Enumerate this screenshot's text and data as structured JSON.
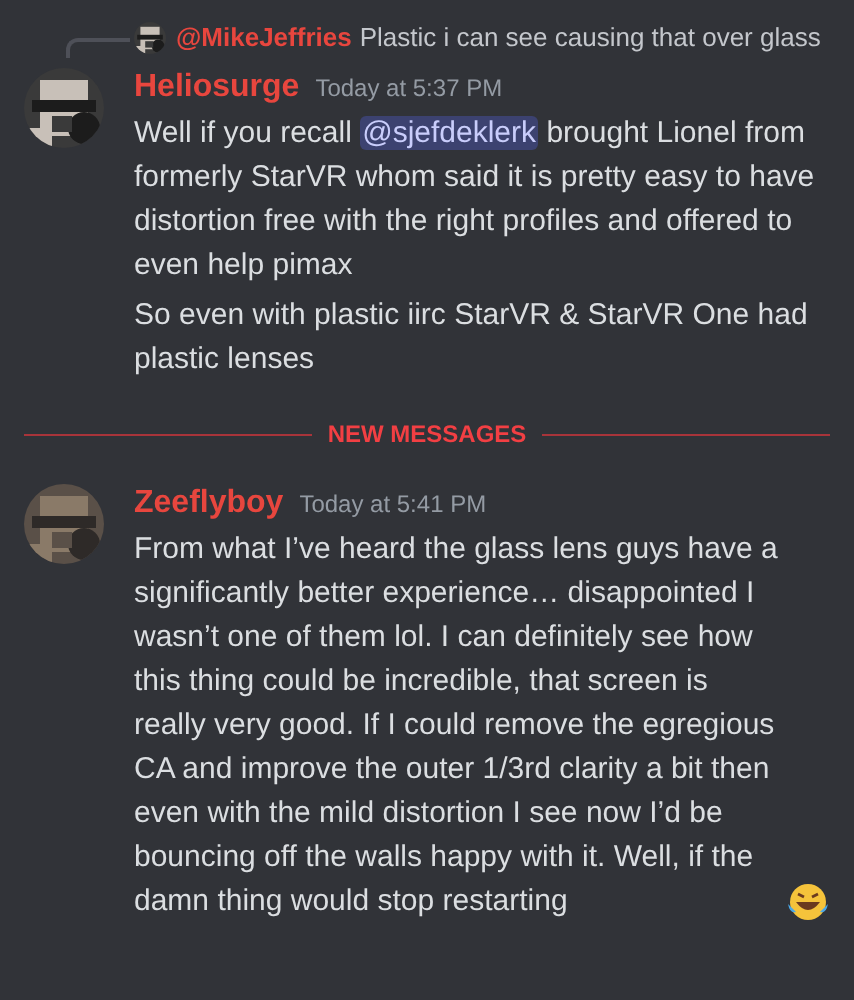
{
  "reply": {
    "author": "@MikeJeffries",
    "text": "Plastic i can see causing that over glass"
  },
  "messages": [
    {
      "author": "Heliosurge",
      "timestamp": "Today at 5:37 PM",
      "paragraphs": [
        [
          {
            "kind": "text",
            "text": "Well if you recall "
          },
          {
            "kind": "mention",
            "text": "@sjefdeklerk"
          },
          {
            "kind": "text",
            "text": " brought Lionel from formerly StarVR whom said it is pretty easy to have distortion free with the right profiles and offered to even help pimax"
          }
        ],
        [
          {
            "kind": "text",
            "text": "So even with plastic iirc StarVR & StarVR One had plastic lenses"
          }
        ]
      ]
    },
    {
      "divider": "NEW MESSAGES",
      "author": "Zeeflyboy",
      "timestamp": "Today at 5:41 PM",
      "paragraphs": [
        [
          {
            "kind": "text",
            "text": "From what I’ve heard the glass lens guys have a significantly better experience… disappointed I wasn’t one of them lol. I can definitely see how this thing could be incredible, that screen is really very good. If I could remove the egregious CA and improve the outer 1/3rd clarity a bit then even with the mild distortion I see now I’d be bouncing off the walls happy with it. Well, if the damn thing would stop restarting"
          },
          {
            "kind": "emoji"
          }
        ]
      ]
    }
  ]
}
